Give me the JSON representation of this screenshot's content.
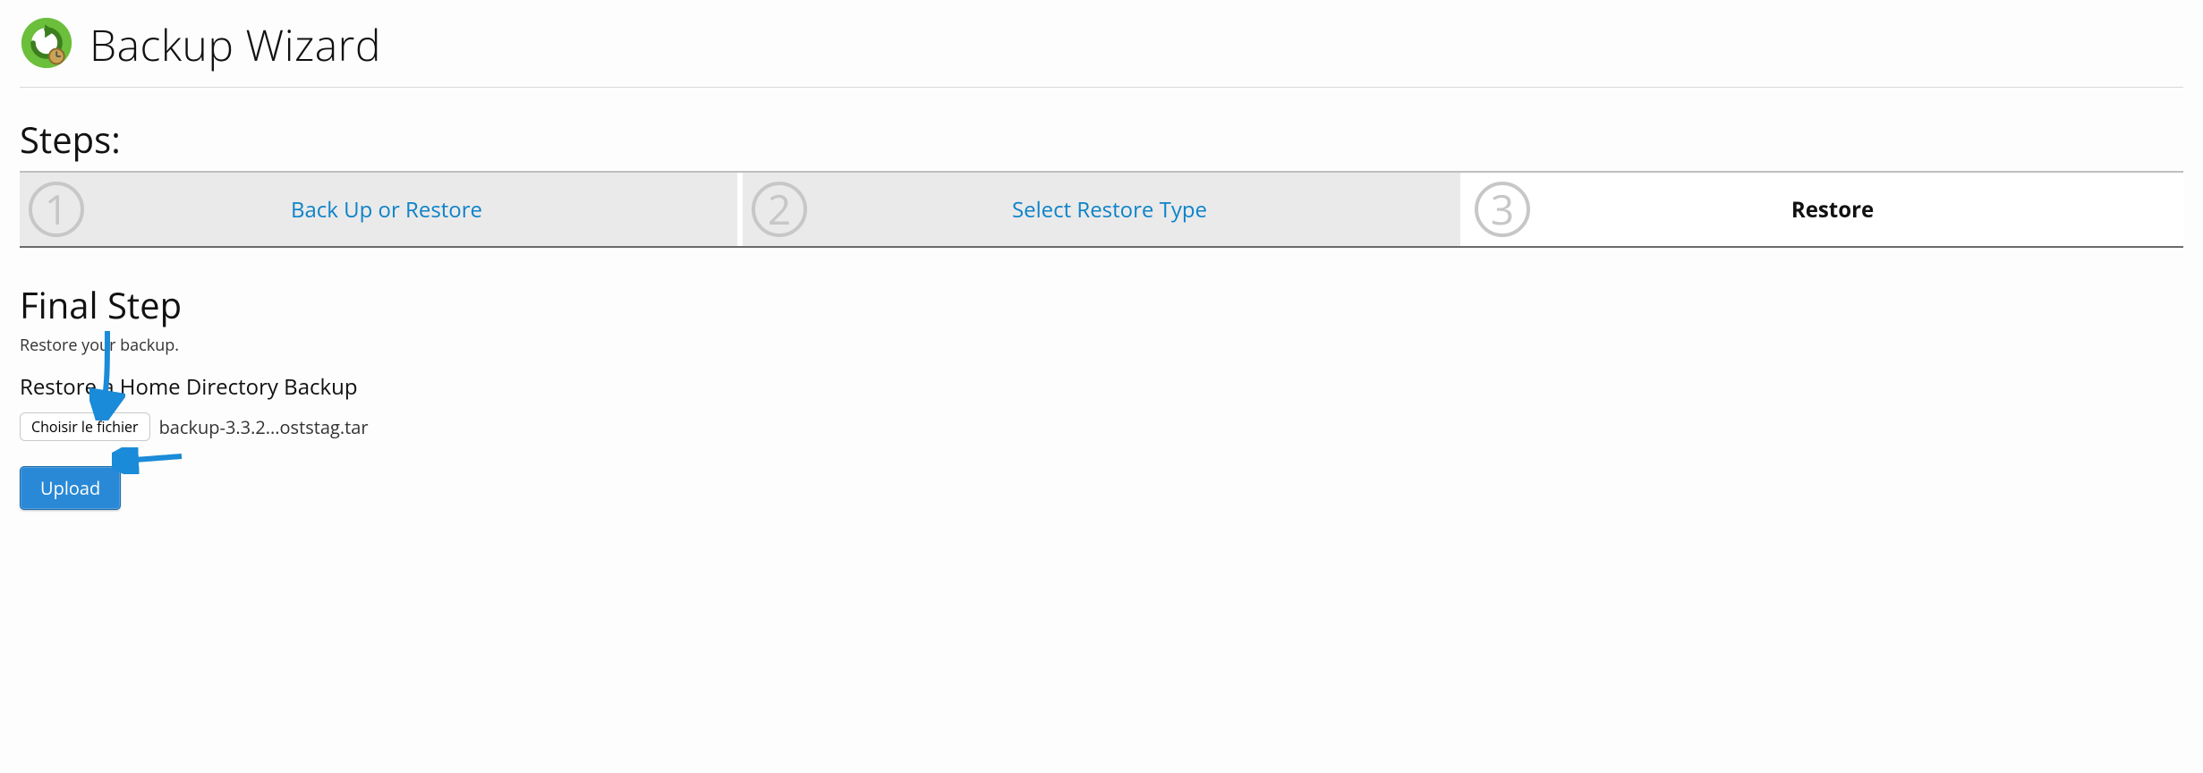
{
  "page": {
    "title": "Backup Wizard"
  },
  "steps": {
    "heading": "Steps:",
    "items": [
      {
        "num": "1",
        "label": "Back Up or Restore",
        "active": false
      },
      {
        "num": "2",
        "label": "Select Restore Type",
        "active": false
      },
      {
        "num": "3",
        "label": "Restore",
        "active": true
      }
    ]
  },
  "final": {
    "heading": "Final Step",
    "sub": "Restore your backup.",
    "restore_type": "Restore a Home Directory Backup",
    "choose_label": "Choisir le fichier",
    "chosen_file": "backup-3.3.2...oststag.tar",
    "upload_label": "Upload"
  },
  "colors": {
    "link": "#0d83c9",
    "btn": "#2a89d6"
  }
}
